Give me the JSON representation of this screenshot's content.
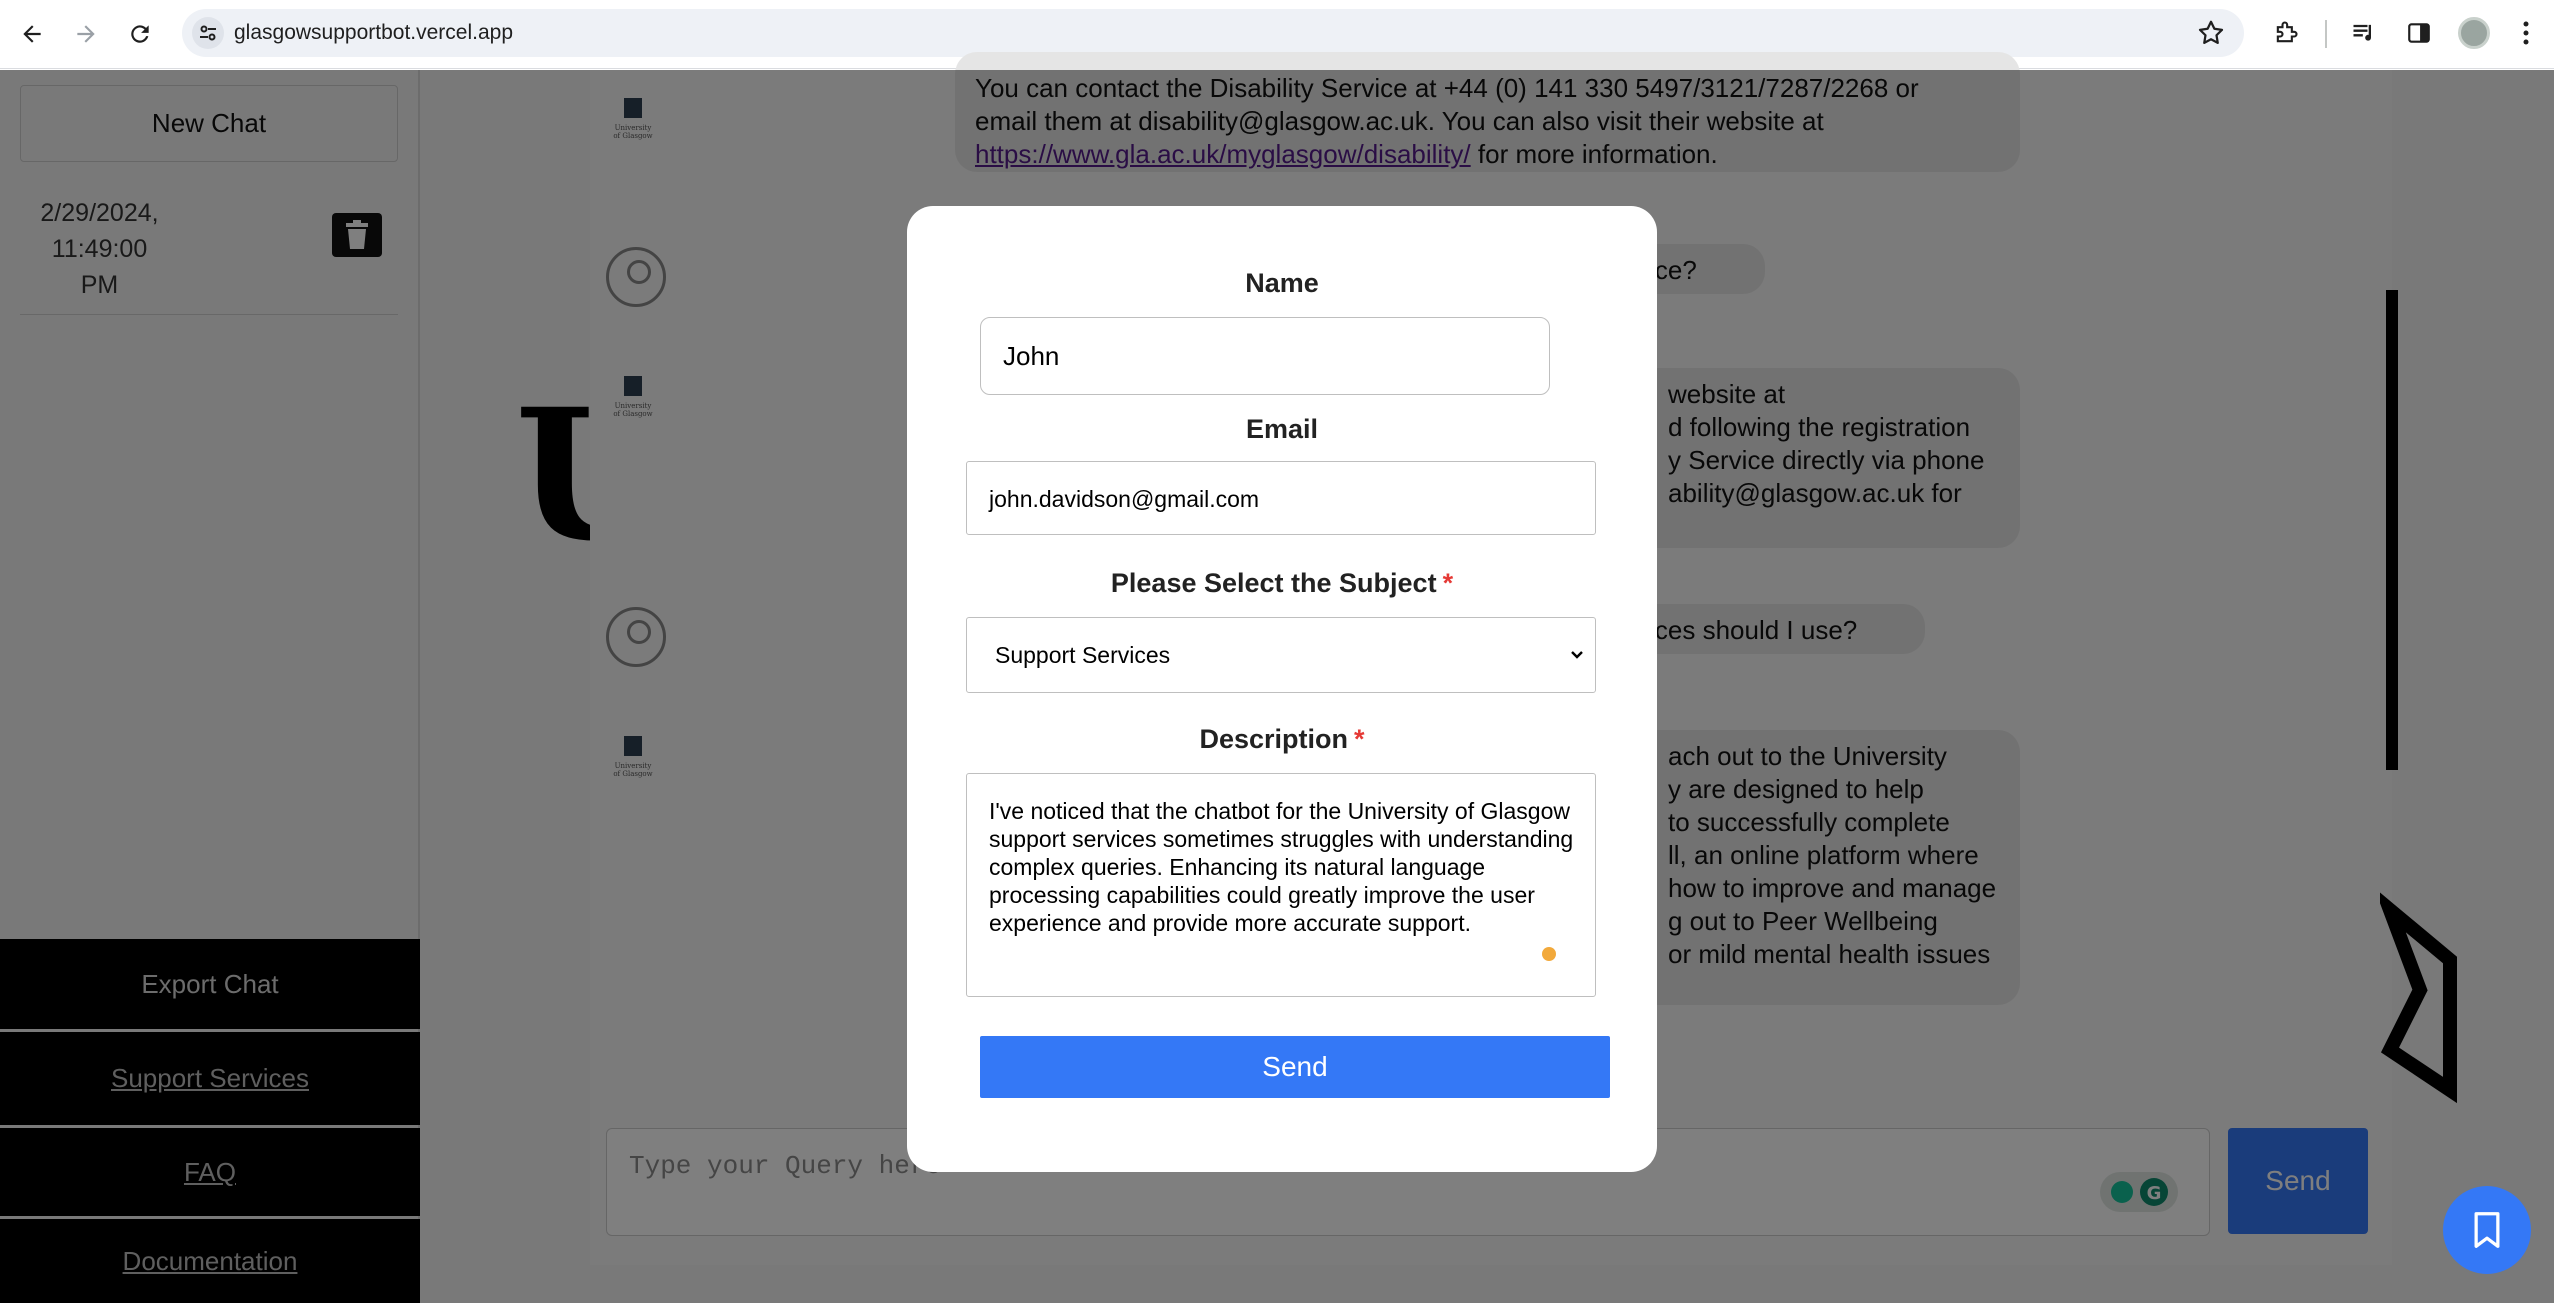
{
  "browser": {
    "url": "glasgowsupportbot.vercel.app"
  },
  "sidebar": {
    "new_chat_label": "New Chat",
    "history": [
      {
        "date_line1": "2/29/2024,",
        "date_line2": "11:49:00",
        "date_line3": "PM"
      }
    ],
    "export_label": "Export Chat",
    "support_label": "Support Services",
    "faq_label": "FAQ",
    "docs_label": "Documentation"
  },
  "chat": {
    "background_letter": "U",
    "messages": [
      {
        "role": "bot",
        "lines": [
          "You can contact the Disability Service at +44 (0) 141 330 5497/3121/7287/2268 or",
          "email them at disability@glasgow.ac.uk. You can also visit their website at"
        ],
        "link": "https://www.gla.ac.uk/myglasgow/disability/",
        "link_suffix": " for more information."
      },
      {
        "role": "user",
        "text": "service?"
      },
      {
        "role": "bot",
        "lines": [
          "website at",
          "d following the registration",
          "y Service directly via phone",
          "ability@glasgow.ac.uk for"
        ]
      },
      {
        "role": "user",
        "text": "services should I use?"
      },
      {
        "role": "bot",
        "lines": [
          "ach out to the University",
          "y are designed to help",
          " to successfully complete",
          "ll, an online platform where",
          " how to improve and manage",
          "g out to Peer Wellbeing",
          "or mild mental health issues"
        ]
      }
    ],
    "query_placeholder": "Type your Query here",
    "send_label": "Send"
  },
  "modal": {
    "name_label": "Name",
    "name_value": "John",
    "email_label": "Email",
    "email_value": "john.davidson@gmail.com",
    "subject_label": "Please Select the Subject",
    "subject_value": "Support Services",
    "description_label": "Description",
    "description_value": "I've noticed that the chatbot for the University of Glasgow support services sometimes struggles with understanding complex queries. Enhancing its natural language processing capabilities could greatly improve the user experience and provide more accurate support.",
    "required_mark": "*",
    "send_label": "Send"
  },
  "colors": {
    "accent": "#3478f6",
    "required": "#e53935",
    "sidebar_button_bg": "#000000"
  }
}
